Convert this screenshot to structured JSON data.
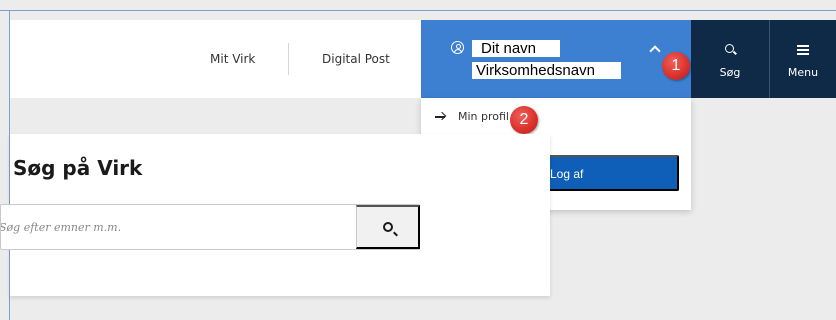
{
  "header": {
    "nav_links": [
      "Mit Virk",
      "Digital Post"
    ]
  },
  "user_menu": {
    "name": "Dit navn",
    "company": "Virksomhedsnavn",
    "dropdown": {
      "profile_link": "Min profil",
      "logout_label": "Log af"
    }
  },
  "actions": {
    "search_label": "Søg",
    "menu_label": "Menu"
  },
  "search_card": {
    "title": "Søg på Virk",
    "placeholder": "Søg efter emner m.m."
  },
  "annotations": {
    "badge_1": "1",
    "badge_2": "2"
  },
  "colors": {
    "user_panel": "#3d7fd1",
    "dark_buttons": "#0e2a46",
    "logout_button": "#0f5fb8",
    "badge": "#d8302b"
  },
  "icons": [
    "user-circle-icon",
    "chevron-up-icon",
    "search-icon",
    "menu-icon",
    "arrow-right-icon",
    "lock-icon",
    "magnifier-icon"
  ]
}
